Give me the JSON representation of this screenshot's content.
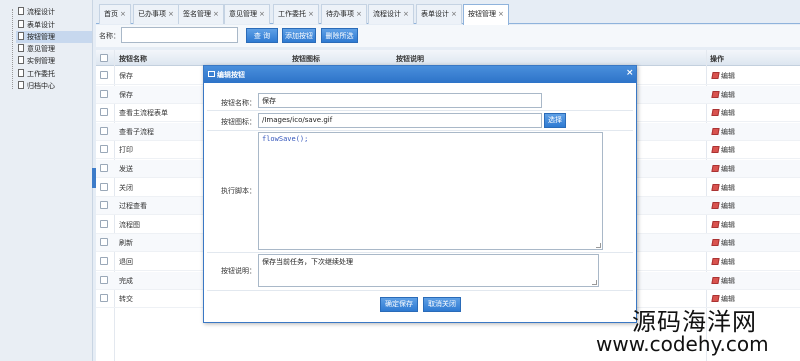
{
  "sidebar": {
    "items": [
      {
        "label": "流程设计",
        "active": false
      },
      {
        "label": "表单设计",
        "active": false
      },
      {
        "label": "按钮管理",
        "active": true
      },
      {
        "label": "意见管理",
        "active": false
      },
      {
        "label": "实例管理",
        "active": false
      },
      {
        "label": "工作委托",
        "active": false
      },
      {
        "label": "归档中心",
        "active": false
      }
    ]
  },
  "tabs": [
    {
      "label": "首页",
      "active": false
    },
    {
      "label": "已办事项",
      "active": false
    },
    {
      "label": "签名管理",
      "active": false
    },
    {
      "label": "意见管理",
      "active": false
    },
    {
      "label": "工作委托",
      "active": false
    },
    {
      "label": "待办事项",
      "active": false
    },
    {
      "label": "流程设计",
      "active": false
    },
    {
      "label": "表单设计",
      "active": false
    },
    {
      "label": "按钮管理",
      "active": true
    }
  ],
  "tab_close_glyph": "×",
  "toolbar": {
    "name_label": "名称：",
    "name_value": "",
    "query_label": "查 询",
    "add_label": "添加按钮",
    "delete_label": "删除所选"
  },
  "grid": {
    "columns": {
      "name": "按钮名称",
      "icon": "按钮图标",
      "desc": "按钮说明",
      "action": "操作"
    },
    "edit_label": "编辑",
    "rows": [
      {
        "name": "保存"
      },
      {
        "name": "保存"
      },
      {
        "name": "查看主流程表单"
      },
      {
        "name": "查看子流程"
      },
      {
        "name": "打印"
      },
      {
        "name": "发送"
      },
      {
        "name": "关闭"
      },
      {
        "name": "过程查看"
      },
      {
        "name": "流程图"
      },
      {
        "name": "刷新"
      },
      {
        "name": "退回"
      },
      {
        "name": "完成"
      },
      {
        "name": "转交"
      }
    ]
  },
  "modal": {
    "title": "编辑按钮",
    "close_glyph": "×",
    "fields": {
      "name_label": "按钮名称：",
      "name_value": "保存",
      "icon_label": "按钮图标：",
      "icon_value": "/Images/ico/save.gif",
      "select_label": "选择",
      "script_label": "执行脚本：",
      "script_value": "flowSave();",
      "desc_label": "按钮说明：",
      "desc_value": "保存当前任务，下次继续处理"
    },
    "save_label": "确定保存",
    "cancel_label": "取消关闭"
  },
  "watermark": {
    "line1": "源码海洋网",
    "line2": "www.codehy.com"
  },
  "colors": {
    "accent": "#2e7ad2",
    "title_bar": "#3a7fd0"
  }
}
